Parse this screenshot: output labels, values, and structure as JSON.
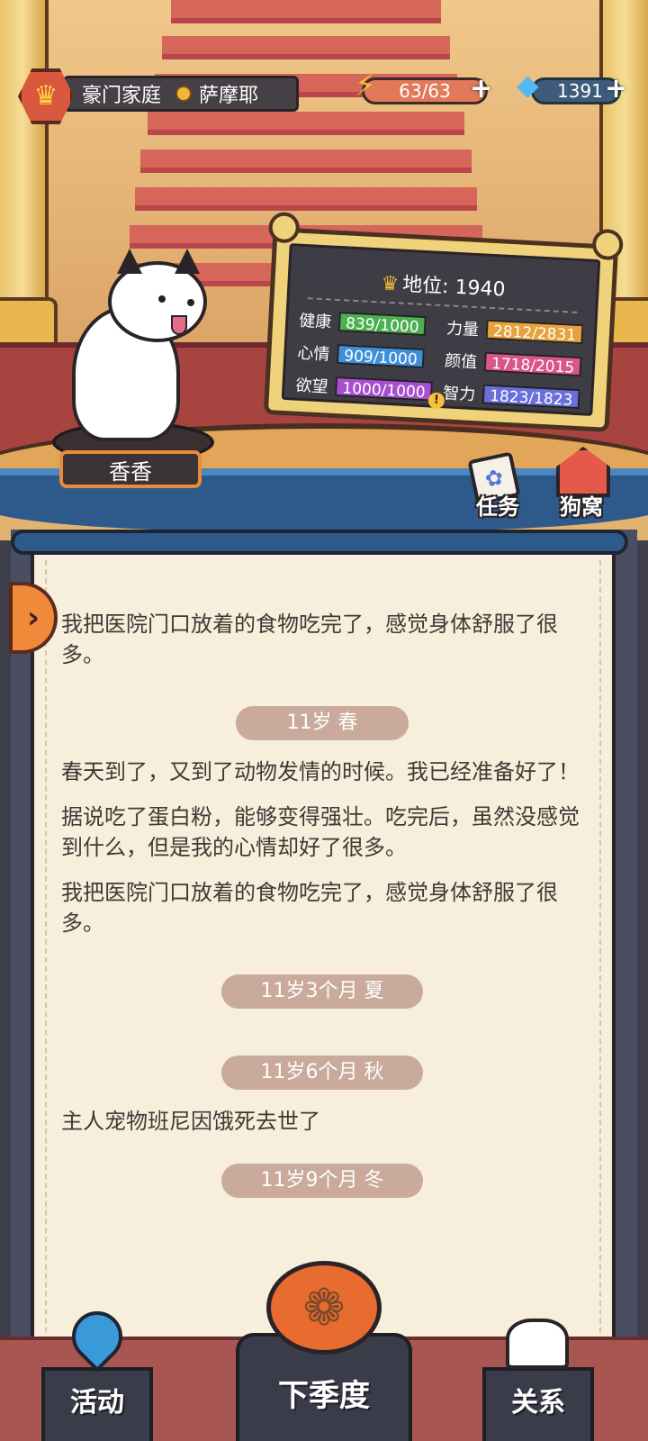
{
  "header": {
    "family_type": "豪门家庭",
    "breed": "萨摩耶",
    "energy": "63/63",
    "gems": "1391"
  },
  "pet": {
    "name": "香香"
  },
  "status_board": {
    "status_label": "地位: 1940",
    "stats": [
      {
        "label": "健康",
        "value": "839/1000",
        "color": "#4caf50"
      },
      {
        "label": "力量",
        "value": "2812/2831",
        "color": "#e6a23c"
      },
      {
        "label": "心情",
        "value": "909/1000",
        "color": "#3f8fd9"
      },
      {
        "label": "颜值",
        "value": "1718/2015",
        "color": "#d9558a"
      },
      {
        "label": "欲望",
        "value": "1000/1000",
        "color": "#a84fd0"
      },
      {
        "label": "智力",
        "value": "1823/1823",
        "color": "#6a6fd9"
      }
    ]
  },
  "shortcuts": {
    "task": "任务",
    "kennel": "狗窝"
  },
  "log": {
    "entries": [
      {
        "type": "text",
        "text": "我把医院门口放着的食物吃完了，感觉身体舒服了很多。"
      },
      {
        "type": "age",
        "text": "11岁 春"
      },
      {
        "type": "text",
        "text": "春天到了，又到了动物发情的时候。我已经准备好了！"
      },
      {
        "type": "text",
        "text": "据说吃了蛋白粉，能够变得强壮。吃完后，虽然没感觉到什么，但是我的心情却好了很多。"
      },
      {
        "type": "text",
        "text": "我把医院门口放着的食物吃完了，感觉身体舒服了很多。"
      },
      {
        "type": "age",
        "text": "11岁3个月 夏"
      },
      {
        "type": "age",
        "text": "11岁6个月 秋"
      },
      {
        "type": "text",
        "text": "主人宠物班尼因饿死去世了"
      },
      {
        "type": "age",
        "text": "11岁9个月 冬"
      }
    ]
  },
  "nav": {
    "activity": "活动",
    "next_season": "下季度",
    "relations": "关系"
  }
}
